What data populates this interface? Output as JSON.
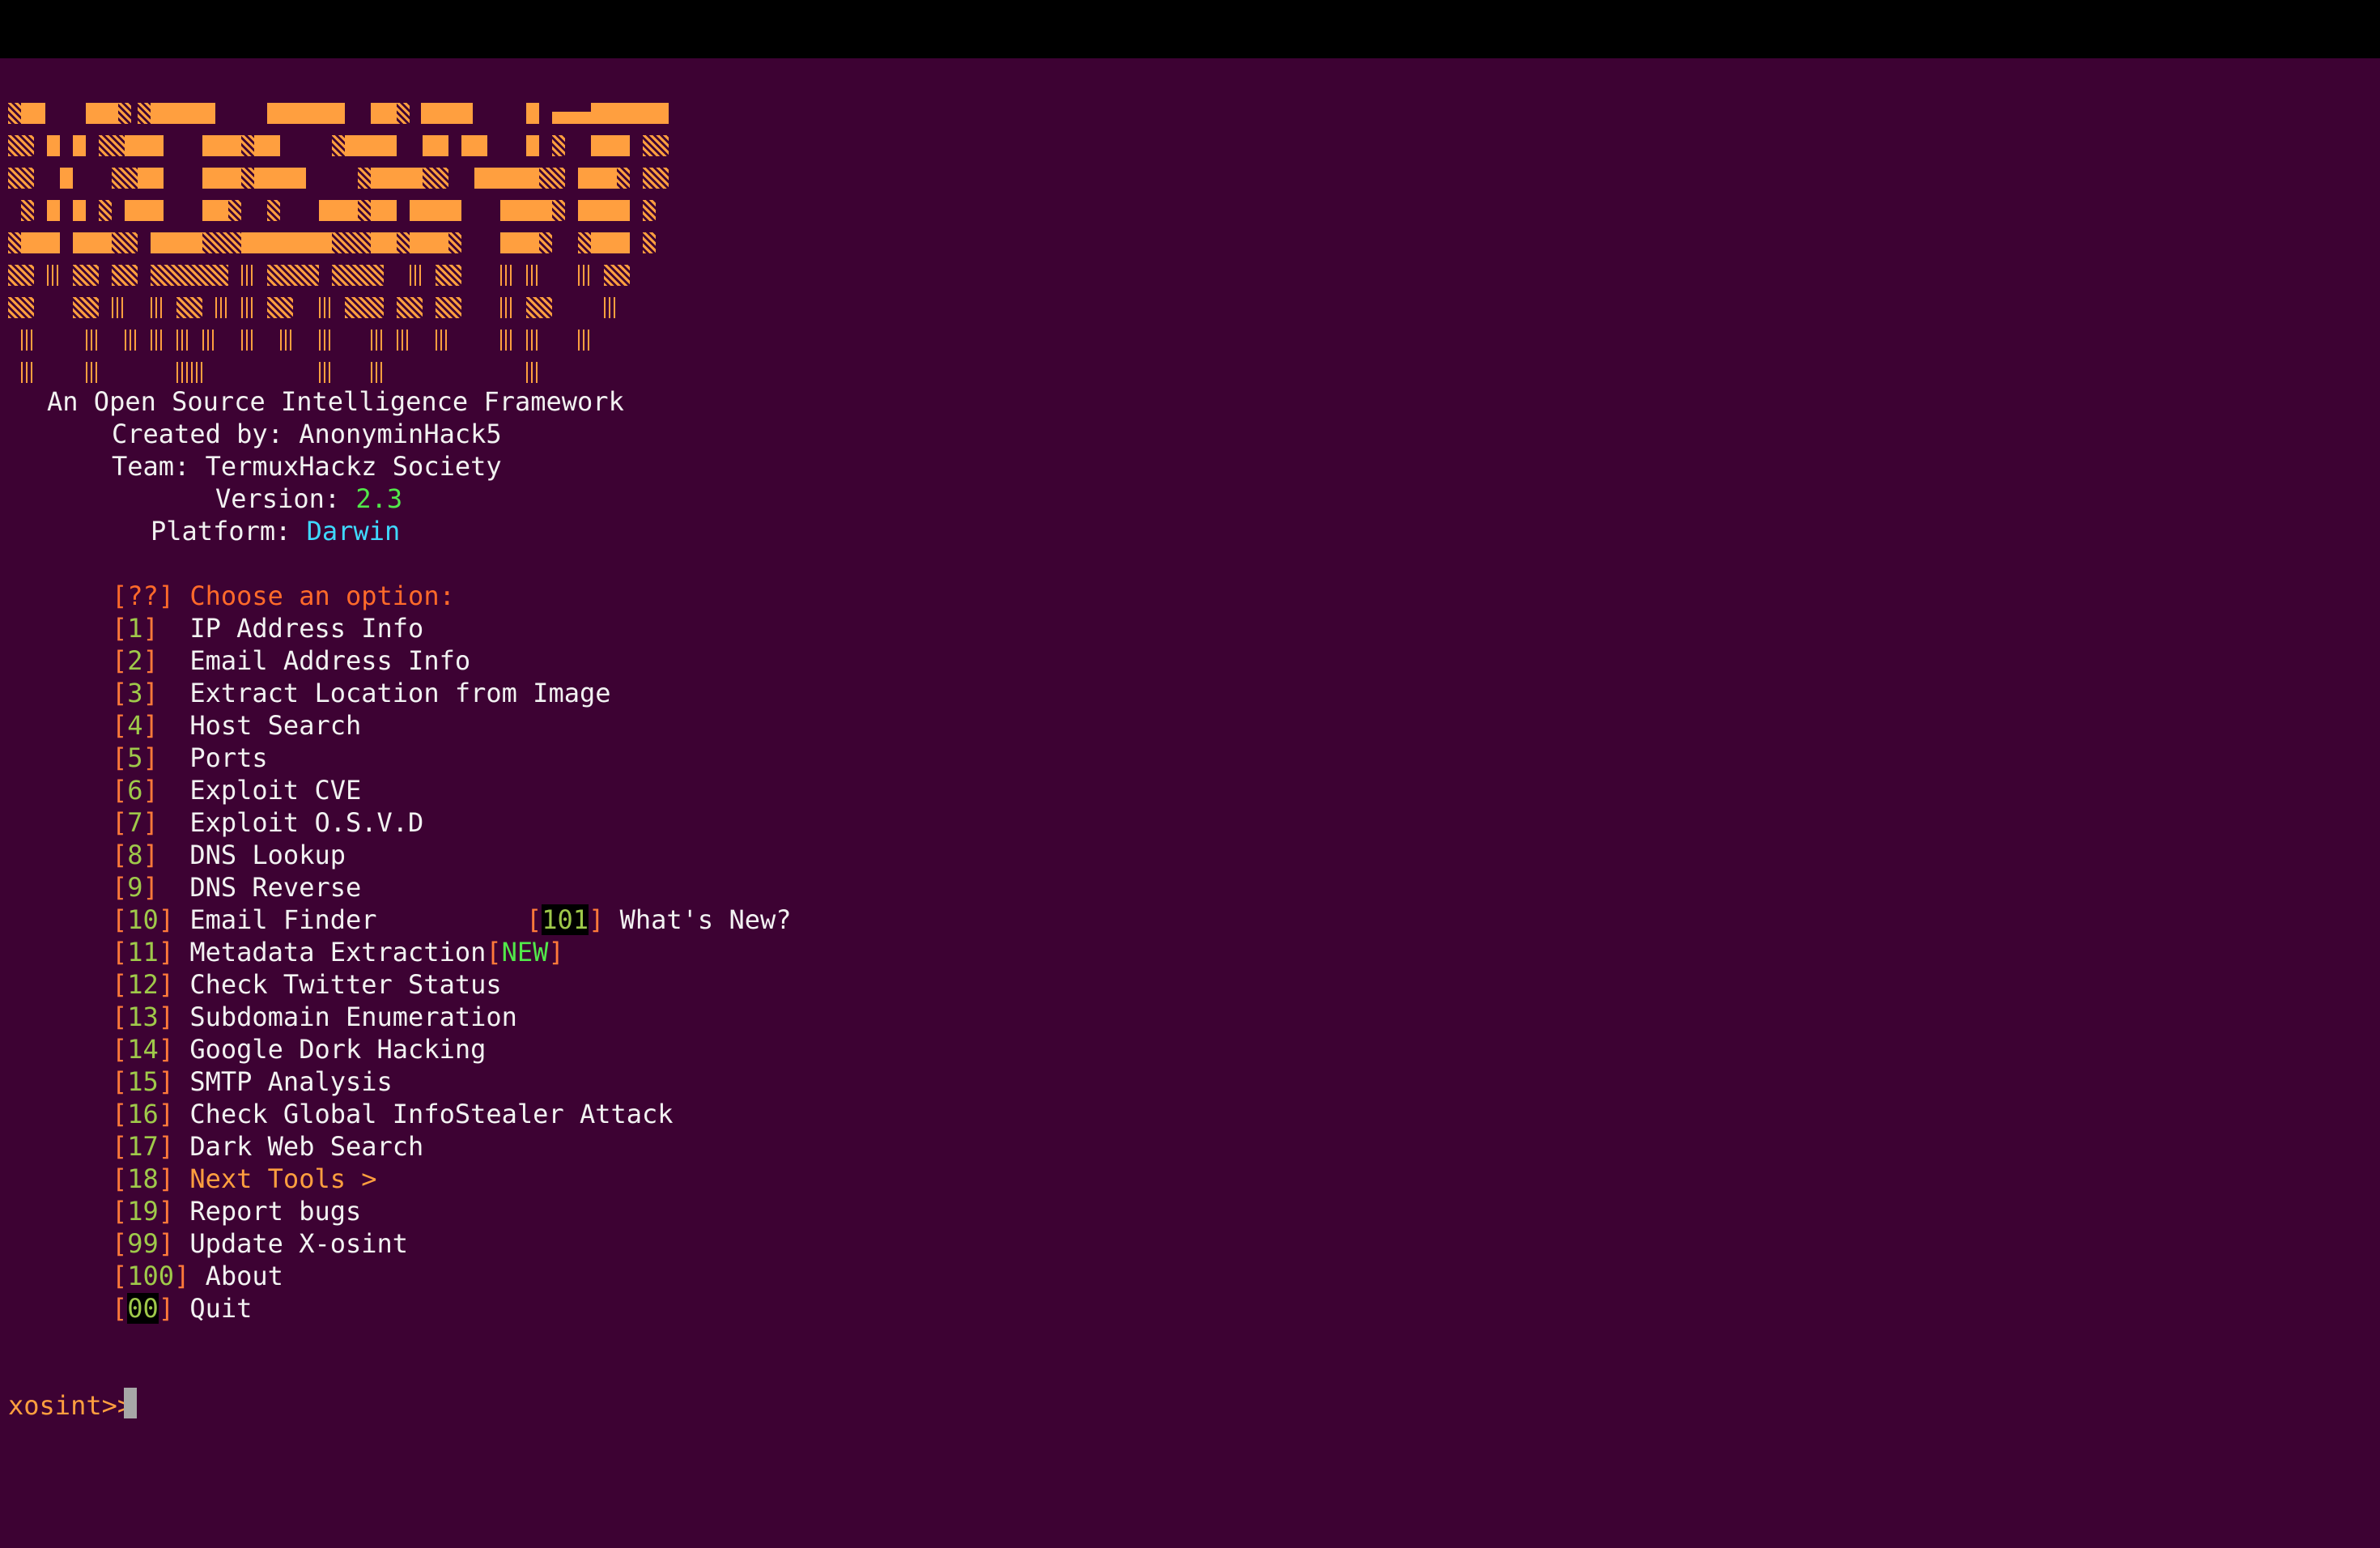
{
  "window": {
    "title": ""
  },
  "colors": {
    "background": "#3d0233",
    "banner": "#ff9f3f",
    "version_value": "#52e84a",
    "platform_value": "#3fd9ff",
    "prompt_header": "#ff6a2a",
    "option_number": "#9fc94a",
    "next_tools": "#ff9f3f"
  },
  "banner": {
    "ascii_art_logo": "X-osint",
    "tagline": "An Open Source Intelligence Framework",
    "created_by_label": "Created by: ",
    "created_by_value": "AnonyminHack5",
    "team_label": "Team: ",
    "team_value": "TermuxHackz Society",
    "version_label": "Version: ",
    "version_value": "2.3",
    "platform_label": "Platform: ",
    "platform_value": "Darwin"
  },
  "menu": {
    "header_bracket": "[??]",
    "header_label": "Choose an option:",
    "options": [
      {
        "num": "1",
        "label": "IP Address Info"
      },
      {
        "num": "2",
        "label": "Email Address Info"
      },
      {
        "num": "3",
        "label": "Extract Location from Image"
      },
      {
        "num": "4",
        "label": "Host Search"
      },
      {
        "num": "5",
        "label": "Ports"
      },
      {
        "num": "6",
        "label": "Exploit CVE"
      },
      {
        "num": "7",
        "label": "Exploit O.S.V.D"
      },
      {
        "num": "8",
        "label": "DNS Lookup"
      },
      {
        "num": "9",
        "label": "DNS Reverse"
      },
      {
        "num": "10",
        "label": "Email Finder"
      },
      {
        "num": "11",
        "label": "Metadata Extraction",
        "tag": "NEW"
      },
      {
        "num": "12",
        "label": "Check Twitter Status"
      },
      {
        "num": "13",
        "label": "Subdomain Enumeration"
      },
      {
        "num": "14",
        "label": "Google Dork Hacking"
      },
      {
        "num": "15",
        "label": "SMTP Analysis"
      },
      {
        "num": "16",
        "label": "Check Global InfoStealer Attack"
      },
      {
        "num": "17",
        "label": "Dark Web Search"
      },
      {
        "num": "18",
        "label": "Next Tools >"
      },
      {
        "num": "19",
        "label": "Report bugs"
      },
      {
        "num": "99",
        "label": "Update X-osint"
      },
      {
        "num": "100",
        "label": "About"
      },
      {
        "num": "00",
        "label": "Quit"
      }
    ],
    "side_option": {
      "num": "101",
      "label": "What's New?"
    }
  },
  "prompt": {
    "text": "xosint>>",
    "input_value": ""
  }
}
